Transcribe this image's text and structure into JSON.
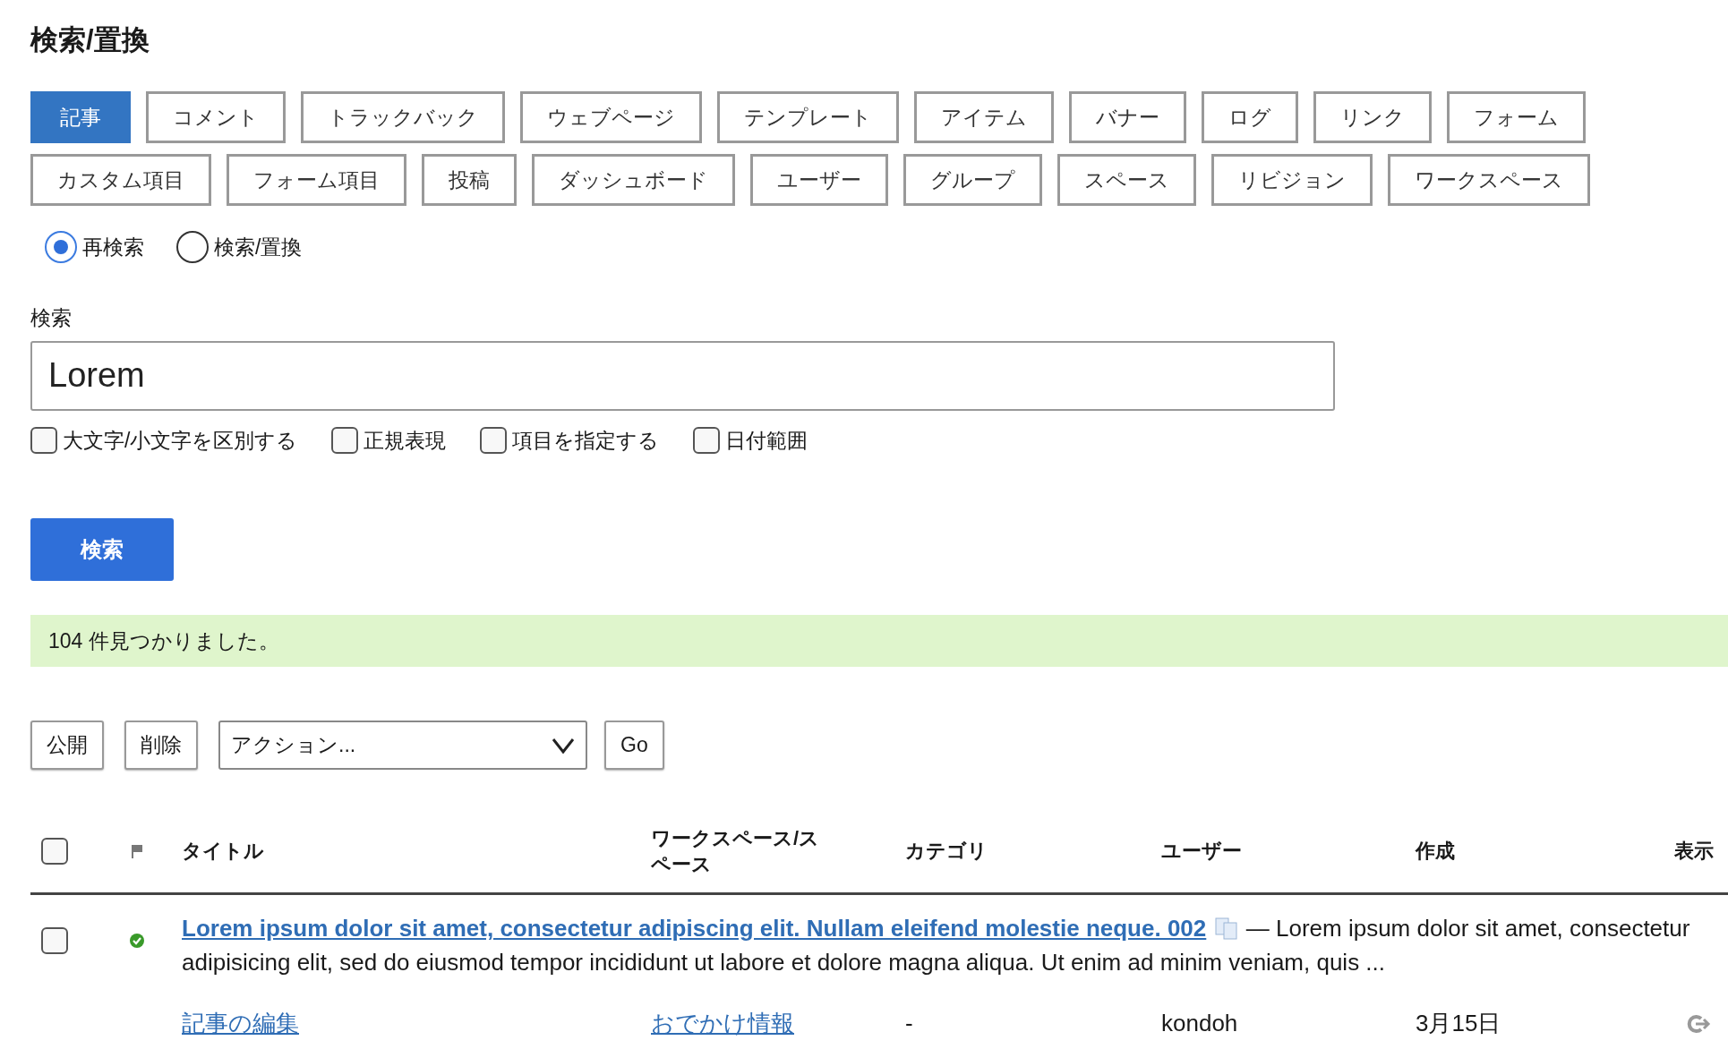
{
  "page_title": "検索/置換",
  "tabs": [
    {
      "label": "記事",
      "selected": true
    },
    {
      "label": "コメント",
      "selected": false
    },
    {
      "label": "トラックバック",
      "selected": false
    },
    {
      "label": "ウェブページ",
      "selected": false
    },
    {
      "label": "テンプレート",
      "selected": false
    },
    {
      "label": "アイテム",
      "selected": false
    },
    {
      "label": "バナー",
      "selected": false
    },
    {
      "label": "ログ",
      "selected": false
    },
    {
      "label": "リンク",
      "selected": false
    },
    {
      "label": "フォーム",
      "selected": false
    },
    {
      "label": "カスタム項目",
      "selected": false
    },
    {
      "label": "フォーム項目",
      "selected": false
    },
    {
      "label": "投稿",
      "selected": false
    },
    {
      "label": "ダッシュボード",
      "selected": false
    },
    {
      "label": "ユーザー",
      "selected": false
    },
    {
      "label": "グループ",
      "selected": false
    },
    {
      "label": "スペース",
      "selected": false
    },
    {
      "label": "リビジョン",
      "selected": false
    },
    {
      "label": "ワークスペース",
      "selected": false
    }
  ],
  "modes": [
    {
      "label": "再検索",
      "selected": true
    },
    {
      "label": "検索/置換",
      "selected": false
    }
  ],
  "search": {
    "label": "検索",
    "value": "Lorem"
  },
  "options": [
    {
      "label": "大文字/小文字を区別する",
      "checked": false
    },
    {
      "label": "正規表現",
      "checked": false
    },
    {
      "label": "項目を指定する",
      "checked": false
    },
    {
      "label": "日付範囲",
      "checked": false
    }
  ],
  "search_button": "検索",
  "message": "104 件見つかりました。",
  "actions": {
    "buttons": [
      "公開",
      "削除"
    ],
    "dropdown": "アクション...",
    "go": "Go"
  },
  "table": {
    "select_all_checked": false,
    "columns": [
      "タイトル",
      "ワークスペース/スペース",
      "カテゴリ",
      "ユーザー",
      "作成",
      "表示"
    ],
    "rows": [
      {
        "checked": false,
        "published": true,
        "title": "Lorem ipsum dolor sit amet, consectetur adipiscing elit. Nullam eleifend molestie neque. 002",
        "excerpt": "— Lorem ipsum dolor sit amet, consectetur adipisicing elit, sed do eiusmod tempor incididunt ut labore et dolore magna aliqua. Ut enim ad minim veniam, quis ...",
        "edit_link": "記事の編集",
        "workspace": "おでかけ情報",
        "category": "-",
        "user": "kondoh",
        "created": "3月15日"
      }
    ]
  }
}
